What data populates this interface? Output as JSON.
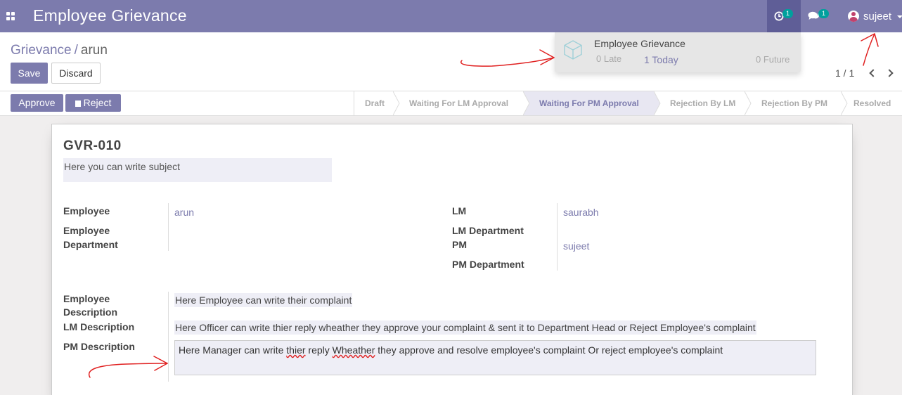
{
  "navbar": {
    "app_title": "Employee Grievance",
    "activity_count": "1",
    "messages_count": "1",
    "user_name": "sujeet",
    "icons": [
      "apps-icon",
      "clock-icon",
      "chat-icon",
      "user-avatar-icon"
    ]
  },
  "breadcrumb": {
    "parent": "Grievance",
    "separator": "/",
    "current": "arun"
  },
  "toolbar": {
    "save_label": "Save",
    "discard_label": "Discard"
  },
  "pager": {
    "value": "1 / 1"
  },
  "activity_dropdown": {
    "title": "Employee Grievance",
    "late": "0 Late",
    "today": "1 Today",
    "future": "0 Future"
  },
  "statusbar": {
    "approve_label": "Approve",
    "reject_label": "Reject",
    "stages": [
      {
        "label": "Draft",
        "active": false
      },
      {
        "label": "Waiting For LM Approval",
        "active": false
      },
      {
        "label": "Waiting For PM Approval",
        "active": true
      },
      {
        "label": "Rejection By LM",
        "active": false
      },
      {
        "label": "Rejection By PM",
        "active": false
      },
      {
        "label": "Resolved",
        "active": false
      }
    ]
  },
  "form": {
    "reference": "GVR-010",
    "subject": "Here you can write subject",
    "employee_label": "Employee",
    "employee_value": "arun",
    "employee_department_label_1": "Employee",
    "employee_department_label_2": "Department",
    "lm_label": "LM",
    "lm_value": "saurabh",
    "lm_department_label": "LM Department",
    "pm_label": "PM",
    "pm_value": "sujeet",
    "pm_department_label": "PM Department",
    "employee_description_label_1": "Employee",
    "employee_description_label_2": "Description",
    "employee_description_value": "Here Employee can write their complaint",
    "lm_description_label": "LM Description",
    "lm_description_value": "Here Officer can write thier reply wheather they approve your complaint & sent it to Department Head or Reject Employee's complaint",
    "pm_description_label": "PM Description",
    "pm_description_parts": [
      "Here Manager can write ",
      "thier",
      " reply ",
      "Wheather",
      " they approve and resolve employee's complaint Or reject employee's complaint"
    ]
  },
  "colors": {
    "brand": "#7c7bad",
    "brand_dark": "#5f5e97",
    "badge": "#00a09d",
    "annotation": "#e02020"
  }
}
